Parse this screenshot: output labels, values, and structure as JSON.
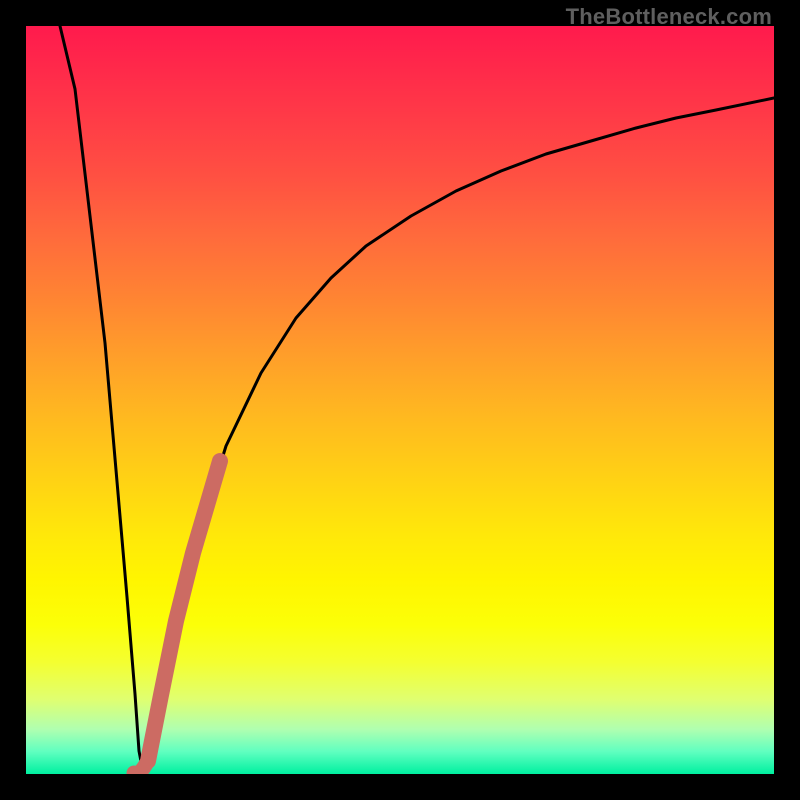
{
  "watermark": "TheBottleneck.com",
  "colors": {
    "frame": "#000000",
    "curve": "#000000",
    "overlay_stroke": "#cc6b63",
    "gradient_top": "#ff1a4d",
    "gradient_bottom": "#00f0a0"
  },
  "chart_data": {
    "type": "line",
    "title": "",
    "xlabel": "",
    "ylabel": "",
    "xlim": [
      0,
      100
    ],
    "ylim": [
      0,
      100
    ],
    "x": [
      0,
      2,
      4,
      6,
      8,
      10,
      11,
      12,
      13,
      14,
      16,
      18,
      20,
      24,
      28,
      32,
      36,
      40,
      45,
      50,
      55,
      60,
      65,
      70,
      75,
      80,
      85,
      90,
      95,
      100
    ],
    "values": [
      100,
      84,
      67,
      50,
      33,
      16,
      8,
      2,
      0,
      3,
      12,
      22,
      31,
      46,
      57,
      65,
      71,
      76,
      80,
      84,
      87,
      89,
      91,
      93,
      94,
      95,
      96,
      97,
      97,
      98
    ],
    "series": [
      {
        "name": "overlay-segment",
        "x": [
          12.0,
          12.3,
          12.6,
          13.0,
          13.8,
          14.8,
          16.0,
          17.2,
          18.4,
          19.6,
          21.0,
          22.2,
          23.2
        ],
        "values": [
          0.0,
          0.5,
          1.0,
          2.0,
          5.0,
          10.0,
          16.0,
          22.0,
          28.0,
          33.5,
          38.5,
          43.0,
          46.0
        ]
      }
    ]
  }
}
